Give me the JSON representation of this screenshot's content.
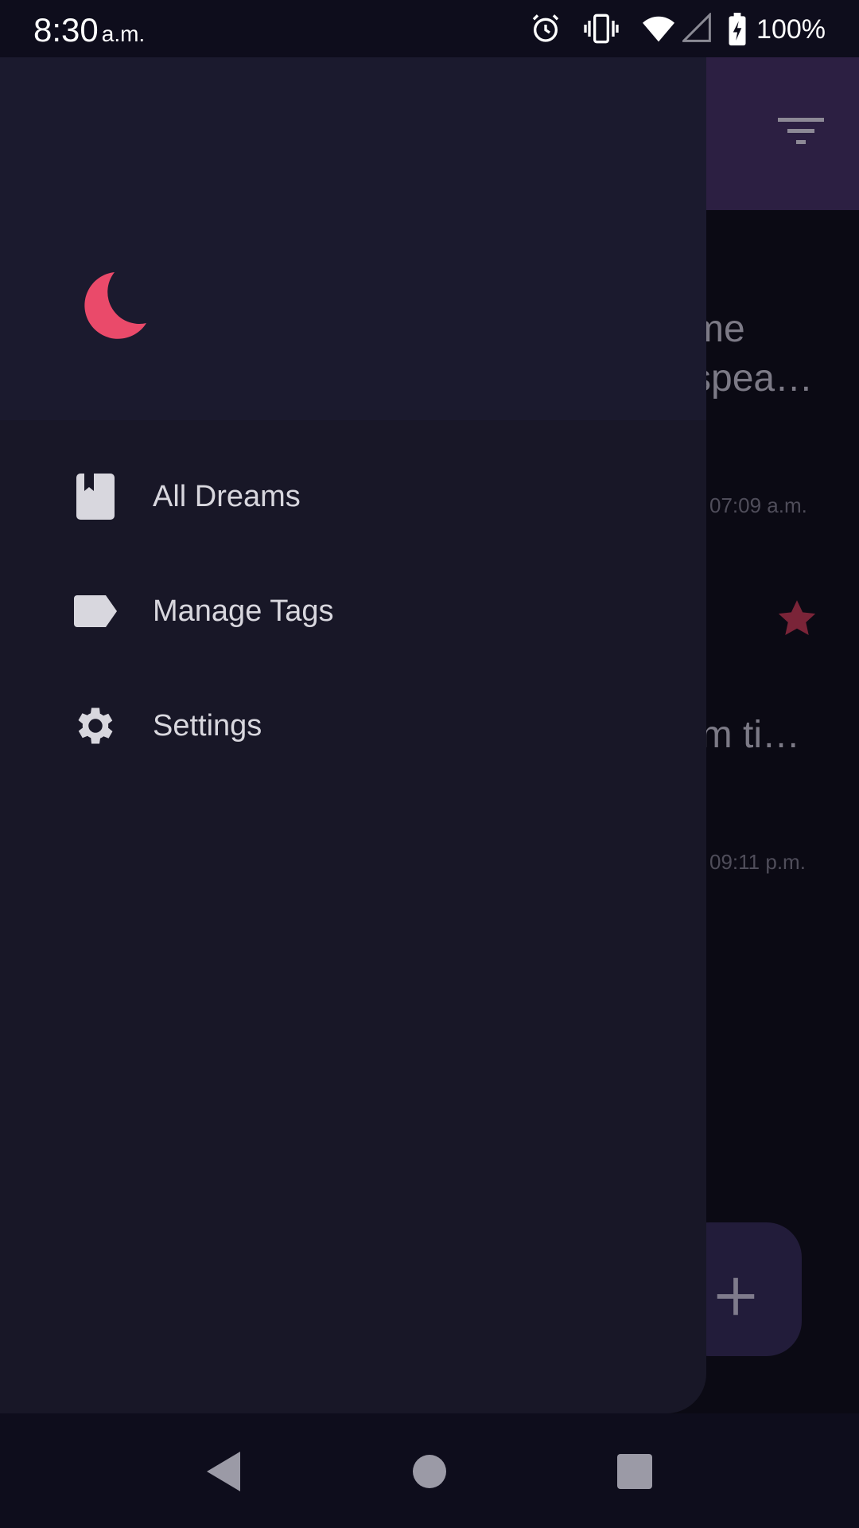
{
  "status_bar": {
    "time": "8:30",
    "ampm": "a.m.",
    "battery": "100%"
  },
  "background": {
    "peek_lines": [
      "me",
      "spea…",
      "lm ti…"
    ],
    "timestamps": [
      "07:09 a.m.",
      "09:11 p.m."
    ],
    "fab_icon": "plus-icon",
    "accent_star": "#7a2438"
  },
  "drawer": {
    "logo_icon": "moon-icon",
    "logo_color": "#ea4a6a",
    "items": [
      {
        "label": "All Dreams",
        "icon": "book-icon"
      },
      {
        "label": "Manage Tags",
        "icon": "tag-icon"
      },
      {
        "label": "Settings",
        "icon": "gear-icon"
      }
    ]
  },
  "colors": {
    "drawer_bg": "#181727",
    "header_bg": "#1b1a2e",
    "app_bar": "#2c1f42",
    "text": "#d8d7de"
  }
}
